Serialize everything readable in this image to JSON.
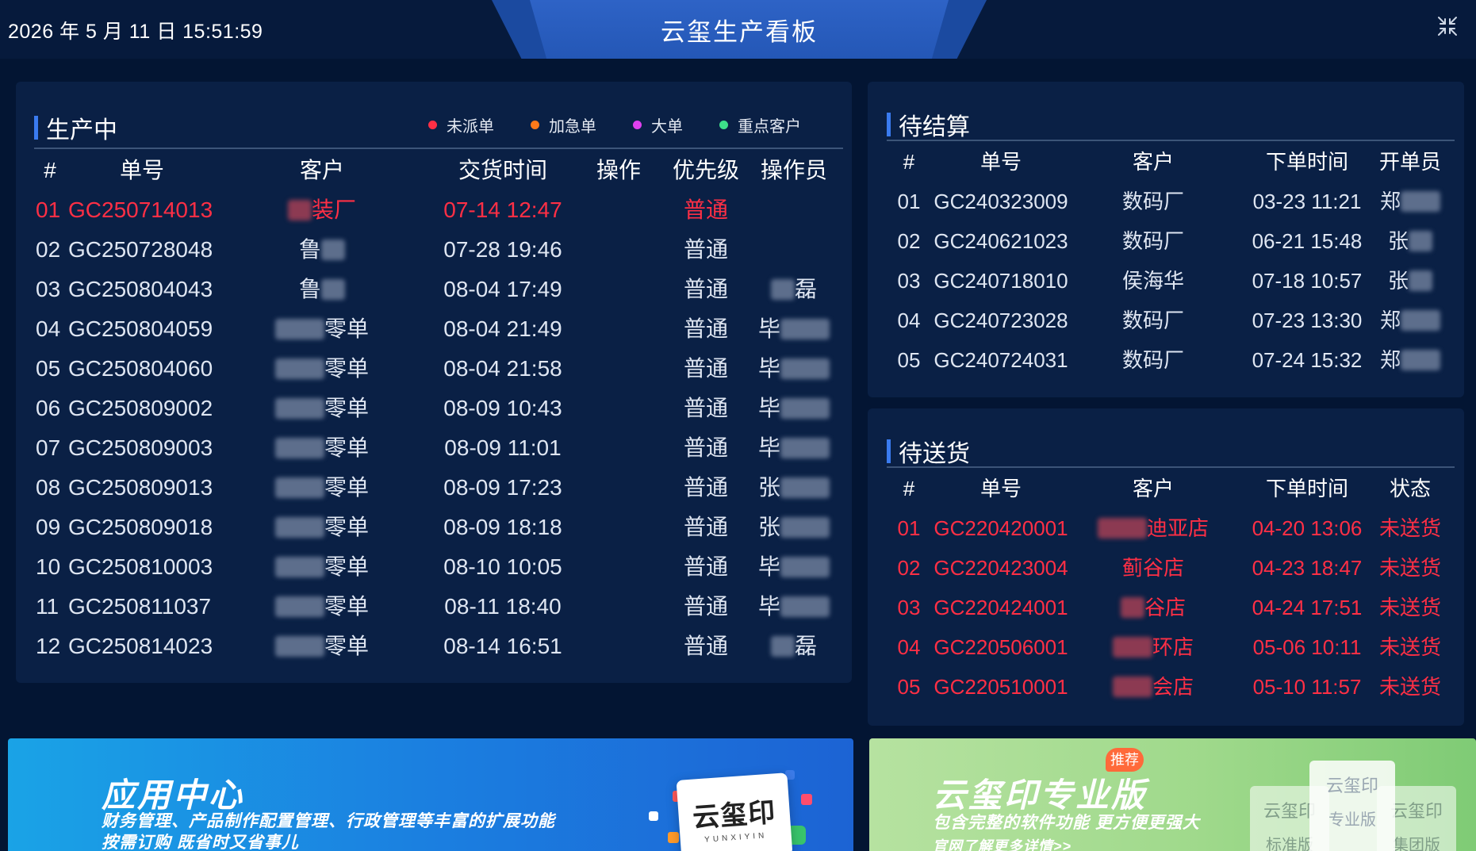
{
  "header": {
    "datetime": "2026 年 5 月 11 日 15:51:59",
    "title": "云玺生产看板",
    "collapse_icon": "collapse-arrows-icon"
  },
  "production": {
    "title": "生产中",
    "legend": [
      {
        "label": "未派单",
        "color": "#ff2f45"
      },
      {
        "label": "加急单",
        "color": "#ff7a1a"
      },
      {
        "label": "大单",
        "color": "#e040f0"
      },
      {
        "label": "重点客户",
        "color": "#3de08a"
      }
    ],
    "headers": {
      "idx": "#",
      "order": "单号",
      "customer": "客户",
      "delivery": "交货时间",
      "action": "操作",
      "priority": "优先级",
      "operator": "操作员"
    },
    "rows": [
      {
        "idx": "01",
        "order": "GC250714013",
        "customer": "装厂",
        "delivery": "07-14 12:47",
        "priority": "普通",
        "operator": "",
        "urgent": true
      },
      {
        "idx": "02",
        "order": "GC250728048",
        "customer": "鲁",
        "delivery": "07-28 19:46",
        "priority": "普通",
        "operator": ""
      },
      {
        "idx": "03",
        "order": "GC250804043",
        "customer": "鲁",
        "delivery": "08-04 17:49",
        "priority": "普通",
        "operator": "磊"
      },
      {
        "idx": "04",
        "order": "GC250804059",
        "customer": "零单",
        "delivery": "08-04 21:49",
        "priority": "普通",
        "operator": "毕"
      },
      {
        "idx": "05",
        "order": "GC250804060",
        "customer": "零单",
        "delivery": "08-04 21:58",
        "priority": "普通",
        "operator": "毕"
      },
      {
        "idx": "06",
        "order": "GC250809002",
        "customer": "零单",
        "delivery": "08-09 10:43",
        "priority": "普通",
        "operator": "毕"
      },
      {
        "idx": "07",
        "order": "GC250809003",
        "customer": "零单",
        "delivery": "08-09 11:01",
        "priority": "普通",
        "operator": "毕"
      },
      {
        "idx": "08",
        "order": "GC250809013",
        "customer": "零单",
        "delivery": "08-09 17:23",
        "priority": "普通",
        "operator": "张"
      },
      {
        "idx": "09",
        "order": "GC250809018",
        "customer": "零单",
        "delivery": "08-09 18:18",
        "priority": "普通",
        "operator": "张"
      },
      {
        "idx": "10",
        "order": "GC250810003",
        "customer": "零单",
        "delivery": "08-10 10:05",
        "priority": "普通",
        "operator": "毕"
      },
      {
        "idx": "11",
        "order": "GC250811037",
        "customer": "零单",
        "delivery": "08-11 18:40",
        "priority": "普通",
        "operator": "毕"
      },
      {
        "idx": "12",
        "order": "GC250814023",
        "customer": "零单",
        "delivery": "08-14 16:51",
        "priority": "普通",
        "operator": "磊"
      }
    ]
  },
  "settlement": {
    "title": "待结算",
    "headers": {
      "idx": "#",
      "order": "单号",
      "customer": "客户",
      "time": "下单时间",
      "clerk": "开单员"
    },
    "rows": [
      {
        "idx": "01",
        "order": "GC240323009",
        "customer": "数码厂",
        "time": "03-23 11:21",
        "clerk": "郑"
      },
      {
        "idx": "02",
        "order": "GC240621023",
        "customer": "数码厂",
        "time": "06-21 15:48",
        "clerk": "张"
      },
      {
        "idx": "03",
        "order": "GC240718010",
        "customer": "侯海华",
        "time": "07-18 10:57",
        "clerk": "张"
      },
      {
        "idx": "04",
        "order": "GC240723028",
        "customer": "数码厂",
        "time": "07-23 13:30",
        "clerk": "郑"
      },
      {
        "idx": "05",
        "order": "GC240724031",
        "customer": "数码厂",
        "time": "07-24 15:32",
        "clerk": "郑"
      }
    ]
  },
  "shipping": {
    "title": "待送货",
    "headers": {
      "idx": "#",
      "order": "单号",
      "customer": "客户",
      "time": "下单时间",
      "status": "状态"
    },
    "rows": [
      {
        "idx": "01",
        "order": "GC220420001",
        "customer": "迪亚店",
        "time": "04-20 13:06",
        "status": "未送货"
      },
      {
        "idx": "02",
        "order": "GC220423004",
        "customer": "蓟谷店",
        "time": "04-23 18:47",
        "status": "未送货"
      },
      {
        "idx": "03",
        "order": "GC220424001",
        "customer": "谷店",
        "time": "04-24 17:51",
        "status": "未送货"
      },
      {
        "idx": "04",
        "order": "GC220506001",
        "customer": "环店",
        "time": "05-06 10:11",
        "status": "未送货"
      },
      {
        "idx": "05",
        "order": "GC220510001",
        "customer": "会店",
        "time": "05-10 11:57",
        "status": "未送货"
      }
    ]
  },
  "banner_app": {
    "title": "应用中心",
    "line1": "财务管理、产品制作配置管理、行政管理等丰富的扩展功能",
    "line2": "按需订购  既省时又省事儿",
    "logo": "云玺印",
    "logo_sub": "YUNXIYIN"
  },
  "banner_pro": {
    "title": "云玺印专业版",
    "badge": "推荐",
    "line1": "包含完整的软件功能  更方便更强大",
    "line2": "官网了解更多详情>>",
    "cards": [
      {
        "logo": "云玺印",
        "label": "标准版"
      },
      {
        "logo": "云玺印",
        "label": "专业版"
      },
      {
        "logo": "云玺印",
        "label": "集团版"
      }
    ]
  }
}
